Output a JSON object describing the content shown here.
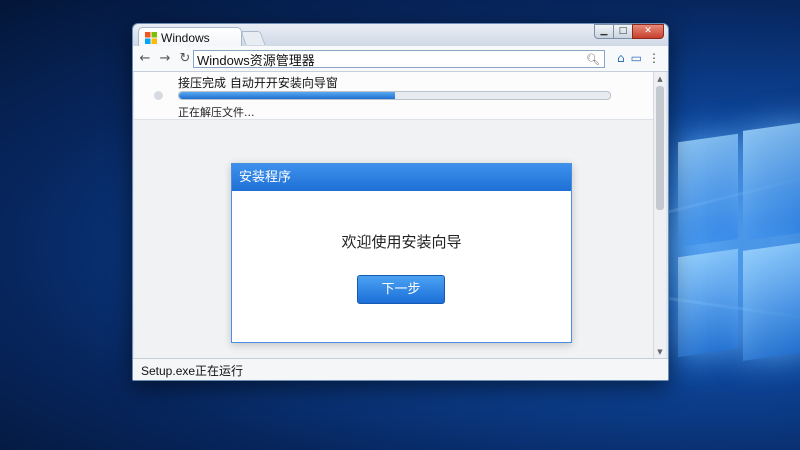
{
  "browser": {
    "tab_title": "Windows",
    "address": "Windows资源管理器",
    "window_controls": {
      "minimize_icon": "minimize-icon",
      "maximize_icon": "maximize-icon",
      "close_icon": "close-icon"
    }
  },
  "status": {
    "heading": "接压完成 自动开开安装向导窗",
    "progress_percent": 50,
    "sub": "正在解压文件..."
  },
  "dialog": {
    "title": "安装程序",
    "message": "欢迎使用安装向导",
    "next_label": "下一步"
  },
  "statusbar": {
    "text": "Setup.exe正在运行"
  },
  "colors": {
    "accent": "#1f6fd6",
    "desktop": "#0c3f8e"
  }
}
